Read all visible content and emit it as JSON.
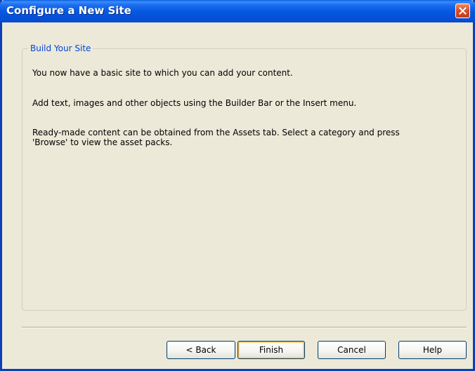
{
  "window": {
    "title": "Configure a New Site"
  },
  "group": {
    "legend": "Build Your Site",
    "paragraphs": [
      "You now have a basic site to which you can add your content.",
      "Add text, images and other objects using the Builder Bar or the Insert menu.",
      "Ready-made content can be obtained from the Assets tab. Select a category and press",
      "'Browse' to view the asset packs."
    ]
  },
  "buttons": {
    "back": "< Back",
    "finish": "Finish",
    "cancel": "Cancel",
    "help": "Help"
  },
  "colors": {
    "titlebar": "#0658e0",
    "dialog_bg": "#ece9d8",
    "legend_text": "#0046d5",
    "close_button": "#d9502a",
    "default_button_highlight": "#f5c15a"
  },
  "icons": {
    "close": "close-icon"
  }
}
